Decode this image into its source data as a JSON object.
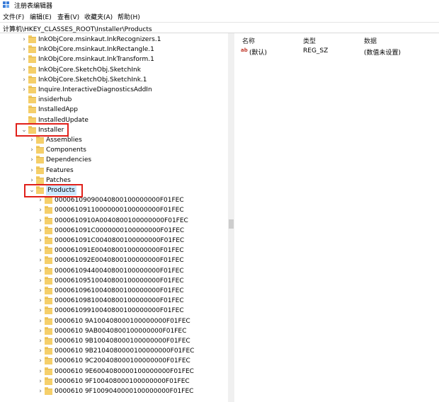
{
  "window": {
    "title": "注册表编辑器"
  },
  "menu": [
    {
      "label": "文件(F)"
    },
    {
      "label": "编辑(E)"
    },
    {
      "label": "查看(V)"
    },
    {
      "label": "收藏夹(A)"
    },
    {
      "label": "帮助(H)"
    }
  ],
  "address": {
    "path": "计算机\\HKEY_CLASSES_ROOT\\Installer\\Products"
  },
  "tree": [
    {
      "label": "InkObjCore.msinkaut.InkRecognizers.1",
      "level": 0,
      "chevron": ">"
    },
    {
      "label": "InkObjCore.msinkaut.InkRectangle.1",
      "level": 0,
      "chevron": ">"
    },
    {
      "label": "InkObjCore.msinkaut.InkTransform.1",
      "level": 0,
      "chevron": ">"
    },
    {
      "label": "InkObjCore.SketchObj.SketchInk",
      "level": 0,
      "chevron": ">"
    },
    {
      "label": "InkObjCore.SketchObj.SketchInk.1",
      "level": 0,
      "chevron": ">"
    },
    {
      "label": "Inquire.InteractiveDiagnosticsAddIn",
      "level": 0,
      "chevron": ">"
    },
    {
      "label": "insiderhub",
      "level": 0,
      "chevron": ""
    },
    {
      "label": "InstalledApp",
      "level": 0,
      "chevron": ""
    },
    {
      "label": "InstalledUpdate",
      "level": 0,
      "chevron": ""
    },
    {
      "label": "Installer",
      "level": 0,
      "chevron": "v"
    },
    {
      "label": "Assemblies",
      "level": 1,
      "chevron": ">"
    },
    {
      "label": "Components",
      "level": 1,
      "chevron": ">"
    },
    {
      "label": "Dependencies",
      "level": 1,
      "chevron": ">"
    },
    {
      "label": "Features",
      "level": 1,
      "chevron": ">"
    },
    {
      "label": "Patches",
      "level": 1,
      "chevron": ">"
    },
    {
      "label": "Products",
      "level": 1,
      "chevron": "v",
      "selected": true
    },
    {
      "label": "00006109090040800100000000F01FEC",
      "level": 2,
      "chevron": ">"
    },
    {
      "label": "00006109110000000100000000F01FEC",
      "level": 2,
      "chevron": ">"
    },
    {
      "label": "0000610910A0040800100000000F01FEC",
      "level": 2,
      "chevron": ">"
    },
    {
      "label": "000061091C0000000100000000F01FEC",
      "level": 2,
      "chevron": ">"
    },
    {
      "label": "000061091C0040800100000000F01FEC",
      "level": 2,
      "chevron": ">"
    },
    {
      "label": "000061091E0040800100000000F01FEC",
      "level": 2,
      "chevron": ">"
    },
    {
      "label": "000061092E0040800100000000F01FEC",
      "level": 2,
      "chevron": ">"
    },
    {
      "label": "00006109440040800100000000F01FEC",
      "level": 2,
      "chevron": ">"
    },
    {
      "label": "00006109510040800100000000F01FEC",
      "level": 2,
      "chevron": ">"
    },
    {
      "label": "00006109610040800100000000F01FEC",
      "level": 2,
      "chevron": ">"
    },
    {
      "label": "00006109810040800100000000F01FEC",
      "level": 2,
      "chevron": ">"
    },
    {
      "label": "00006109910040800100000000F01FEC",
      "level": 2,
      "chevron": ">"
    },
    {
      "label": "0000610 9A100408000100000000F01FEC",
      "level": 2,
      "chevron": ">"
    },
    {
      "label": "0000610 9AB0040800100000000F01FEC",
      "level": 2,
      "chevron": ">"
    },
    {
      "label": "0000610 9B100408000100000000F01FEC",
      "level": 2,
      "chevron": ">"
    },
    {
      "label": "0000610 9B2104080000100000000F01FEC",
      "level": 2,
      "chevron": ">"
    },
    {
      "label": "0000610 9C200408000100000000F01FEC",
      "level": 2,
      "chevron": ">"
    },
    {
      "label": "0000610 9E6004080000100000000F01FEC",
      "level": 2,
      "chevron": ">"
    },
    {
      "label": "0000610 9F100408000100000000F01FEC",
      "level": 2,
      "chevron": ">"
    },
    {
      "label": "0000610 9F1009040000100000000F01FEC",
      "level": 2,
      "chevron": ">"
    }
  ],
  "values": {
    "headers": {
      "name": "名称",
      "type": "类型",
      "data": "数据"
    },
    "rows": [
      {
        "name": "(默认)",
        "type": "REG_SZ",
        "data": "(数值未设置)",
        "icon": "string-value-icon"
      }
    ]
  },
  "accent": {
    "highlight": "#e0201a",
    "folder": "#f5cf6a",
    "selection": "#cce8ff"
  }
}
